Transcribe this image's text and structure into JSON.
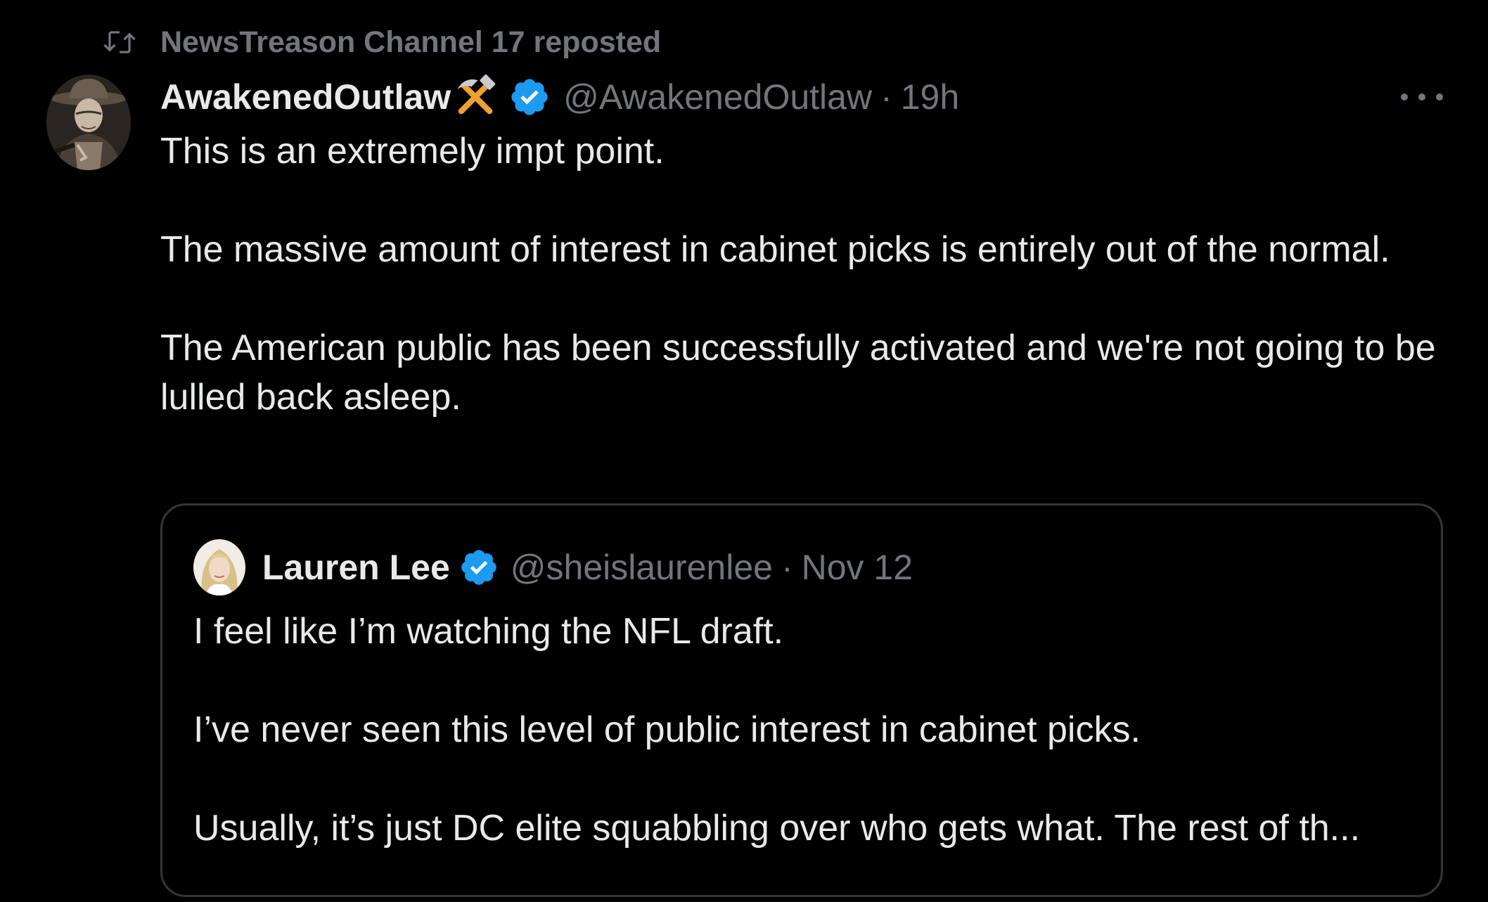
{
  "repost": {
    "label": "NewsTreason Channel 17 reposted",
    "icon": "repost-icon"
  },
  "tweet": {
    "display_name": "AwakenedOutlaw",
    "name_emoji": "hammer-and-pick-icon",
    "verified": true,
    "handle": "@AwakenedOutlaw",
    "separator": "·",
    "time": "19h",
    "paragraphs": [
      "This is an extremely impt point.",
      "The massive amount of interest in cabinet picks is entirely out of the normal.",
      "The American public has been successfully activated and we're not going to be lulled back asleep."
    ]
  },
  "quote": {
    "display_name": "Lauren Lee",
    "verified": true,
    "handle": "@sheislaurenlee",
    "separator": "·",
    "time": "Nov 12",
    "paragraphs": [
      "I feel like I’m watching the NFL draft.",
      "I’ve never seen this level of public interest in cabinet picks.",
      "Usually, it’s just DC elite squabbling over who gets what. The rest of th..."
    ]
  },
  "colors": {
    "background": "#000000",
    "text_primary": "#e7e9ea",
    "text_secondary": "#71767b",
    "verified_blue": "#1d9bf0",
    "border": "#333639",
    "emoji_orange": "#f0a030"
  }
}
